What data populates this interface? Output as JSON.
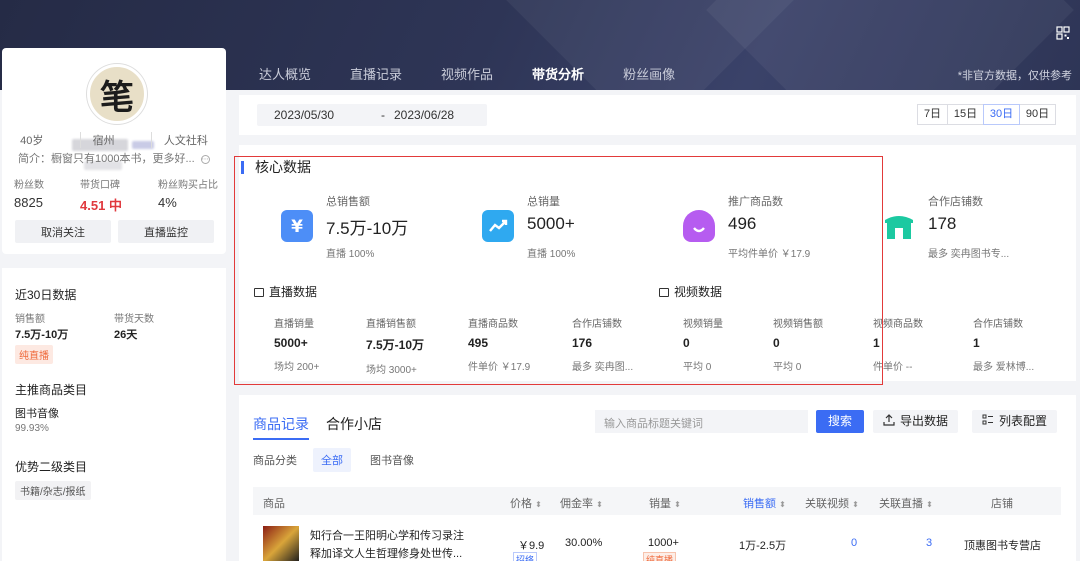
{
  "header": {
    "tabs": [
      "达人概览",
      "直播记录",
      "视频作品",
      "带货分析",
      "粉丝画像"
    ],
    "active_tab": "带货分析",
    "note": "*非官方数据，仅供参考"
  },
  "profile": {
    "avatar_char": "笔",
    "age": "40岁",
    "city": "宿州",
    "category": "人文社科",
    "bio": "简介：橱窗只有1000本书，更多好...",
    "stats": [
      {
        "label": "粉丝数",
        "value": "8825"
      },
      {
        "label": "带货口碑",
        "value": "4.51 中"
      },
      {
        "label": "粉丝购买占比",
        "value": "4%"
      }
    ],
    "unfollow_label": "取消关注",
    "monitor_label": "直播监控"
  },
  "side30": {
    "title": "近30日数据",
    "sales_label": "销售额",
    "sales_value": "7.5万-10万",
    "days_label": "带货天数",
    "days_value": "26天",
    "tag": "纯直播",
    "main_cat_title": "主推商品类目",
    "main_cat": "图书音像",
    "main_cat_pct": "99.93%",
    "sub_cat_title": "优势二级类目",
    "sub_cat": "书籍/杂志/报纸"
  },
  "datebar": {
    "start": "2023/05/30",
    "sep": "-",
    "end": "2023/06/28",
    "ranges": [
      "7日",
      "15日",
      "30日",
      "90日"
    ],
    "active_range": "30日"
  },
  "core": {
    "title": "核心数据",
    "kpis": [
      {
        "label": "总销售额",
        "value": "7.5万-10万",
        "sub": "直播 100%",
        "icon": "yen-icon",
        "color": "#4d8ef7"
      },
      {
        "label": "总销量",
        "value": "5000+",
        "sub": "直播 100%",
        "icon": "trend-icon",
        "color": "#2fa9f0"
      },
      {
        "label": "推广商品数",
        "value": "496",
        "sub": "平均件单价 ￥17.9",
        "icon": "bag-icon",
        "color": "#b65cf0"
      },
      {
        "label": "合作店铺数",
        "value": "178",
        "sub": "最多 奕冉图书专...",
        "icon": "shop-icon",
        "color": "#1cc9a1"
      }
    ],
    "live_title": "直播数据",
    "video_title": "视频数据",
    "live": [
      {
        "label": "直播销量",
        "value": "5000+",
        "sub": "场均 200+"
      },
      {
        "label": "直播销售额",
        "value": "7.5万-10万",
        "sub": "场均 3000+"
      },
      {
        "label": "直播商品数",
        "value": "495",
        "sub": "件单价 ￥17.9"
      },
      {
        "label": "合作店铺数",
        "value": "176",
        "sub": "最多 奕冉图..."
      }
    ],
    "video": [
      {
        "label": "视频销量",
        "value": "0",
        "sub": "平均 0"
      },
      {
        "label": "视频销售额",
        "value": "0",
        "sub": "平均 0"
      },
      {
        "label": "视频商品数",
        "value": "1",
        "sub": "件单价 --"
      },
      {
        "label": "合作店铺数",
        "value": "1",
        "sub": "最多 爱林博..."
      }
    ]
  },
  "list": {
    "tabs": [
      "商品记录",
      "合作小店"
    ],
    "search_placeholder": "输入商品标题关键词",
    "search_label": "搜索",
    "export_label": "导出数据",
    "config_label": "列表配置",
    "cat_label": "商品分类",
    "cats": [
      "全部",
      "图书音像"
    ],
    "columns": [
      "商品",
      "价格",
      "佣金率",
      "销量",
      "销售额",
      "关联视频",
      "关联直播",
      "店铺"
    ],
    "rows": [
      {
        "title1": "知行合一王阳明心学和传习录注",
        "title2": "释加译文人生哲理修身处世传...",
        "price": "￥9.9",
        "price_tag": "招络",
        "commission": "30.00%",
        "sales": "1000+",
        "sales_tag": "纯直播",
        "revenue": "1万-2.5万",
        "videos": "0",
        "lives": "3",
        "shop": "顶惠图书专营店"
      }
    ]
  }
}
